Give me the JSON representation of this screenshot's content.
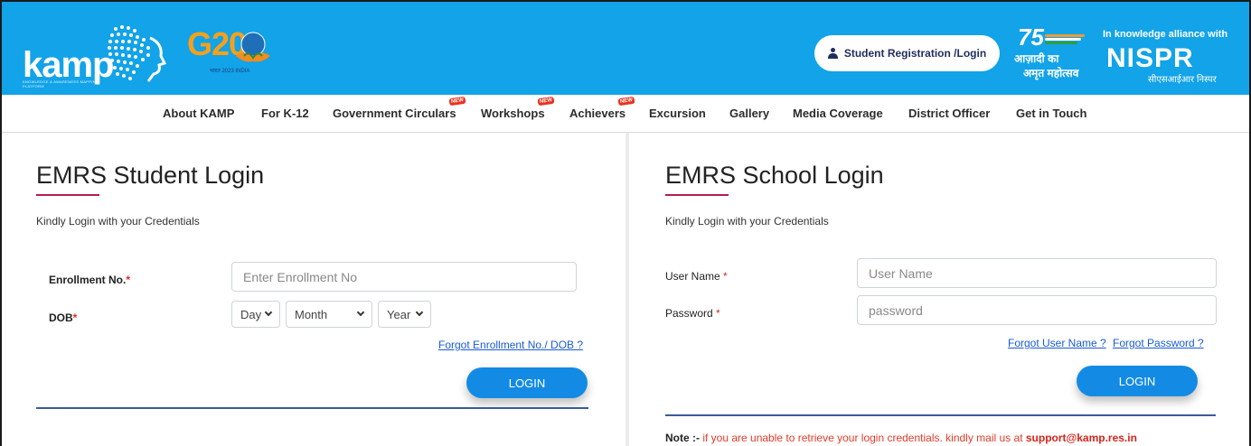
{
  "header": {
    "logo_text": "kamp",
    "logo_subtitle": "KNOWLEDGE & AWARENESS MAPPING PLATFORM",
    "g20_text": "G20",
    "g20_sub": "भारत 2023 INDIA",
    "register_button": "Student Registration /Login",
    "azadi_line1": "आज़ादी का",
    "azadi_line2": "अमृत महोत्सव",
    "alliance_heading": "In knowledge alliance with",
    "alliance_logo": "NISPR",
    "alliance_sub": "सीएसआईआर निस्पर",
    "colors": {
      "header_bg": "#12a3e9",
      "accent_underline": "#b81b54",
      "login_button": "#138be5"
    }
  },
  "nav": {
    "items": [
      {
        "label": "About KAMP",
        "new": false
      },
      {
        "label": "For K-12",
        "new": false
      },
      {
        "label": "Government Circulars",
        "new": true
      },
      {
        "label": "Workshops",
        "new": true
      },
      {
        "label": "Achievers",
        "new": true
      },
      {
        "label": "Excursion",
        "new": false
      },
      {
        "label": "Gallery",
        "new": false
      },
      {
        "label": "Media Coverage",
        "new": false
      },
      {
        "label": "District Officer",
        "new": false
      },
      {
        "label": "Get in Touch",
        "new": false
      }
    ],
    "new_badge": "NEW"
  },
  "student_login": {
    "title": "EMRS Student Login",
    "subtitle": "Kindly Login with your Credentials",
    "enrollment_label": "Enrollment No.",
    "enrollment_placeholder": "Enter Enrollment No",
    "dob_label": "DOB",
    "day": "Day",
    "month": "Month",
    "year": "Year",
    "forgot_link": "Forgot Enrollment No./ DOB ?",
    "login_button": "LOGIN"
  },
  "school_login": {
    "title": "EMRS School Login",
    "subtitle": "Kindly Login with your Credentials",
    "username_label": "User Name",
    "username_placeholder": "User Name",
    "password_label": "Password",
    "password_placeholder": "password",
    "forgot_username": "Forgot User Name ?",
    "forgot_password": "Forgot Password ?",
    "login_button": "LOGIN",
    "note_label": "Note :-",
    "note_text": "if you are unable to retrieve your login credentials. kindly mail us at",
    "note_email": "support@kamp.res.in"
  }
}
